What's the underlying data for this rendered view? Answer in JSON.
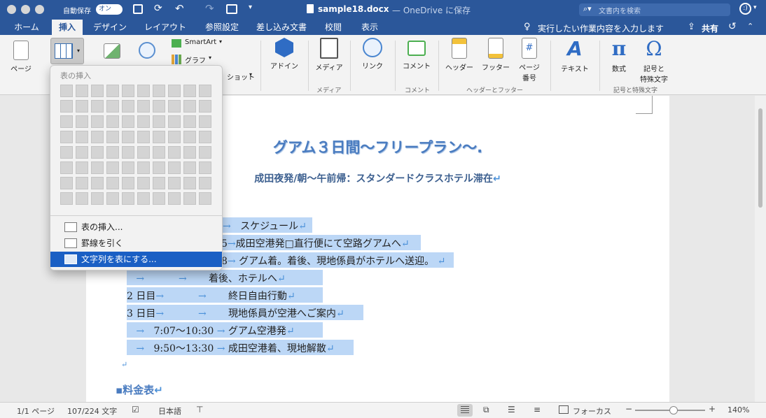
{
  "titlebar": {
    "autosave_label": "自動保存",
    "autosave_toggle": "オン",
    "doc_title": "sample18.docx",
    "doc_suffix": "— OneDrive に保存",
    "search_placeholder": "文書内を検索"
  },
  "tabs": [
    {
      "label": "ホーム"
    },
    {
      "label": "挿入"
    },
    {
      "label": "デザイン"
    },
    {
      "label": "レイアウト"
    },
    {
      "label": "参照設定"
    },
    {
      "label": "差し込み文書"
    },
    {
      "label": "校閲"
    },
    {
      "label": "表示"
    }
  ],
  "tell_me": "実行したい作業内容を入力します",
  "share": "共有",
  "ribbon": {
    "page": "ページ",
    "smartart": "SmartArt",
    "graph": "グラフ",
    "screenshot": "ショット",
    "addin": "アドイン",
    "media": "メディア",
    "link": "リンク",
    "comment": "コメント",
    "header": "ヘッダー",
    "footer": "フッター",
    "page_number_1": "ページ",
    "page_number_2": "番号",
    "textbox": "テキスト",
    "equation": "数式",
    "symbol_1": "記号と",
    "symbol_2": "特殊文字",
    "groups": {
      "media": "メディア",
      "comment": "コメント",
      "header_footer": "ヘッダーとフッター",
      "symbols": "記号と特殊文字"
    }
  },
  "dropdown": {
    "header": "表の挿入",
    "items": [
      {
        "label": "表の挿入..."
      },
      {
        "label": "罫線を引く"
      },
      {
        "label": "文字列を表にする..."
      }
    ]
  },
  "document": {
    "title": "グアム３日間〜フリープラン〜",
    "subtitle": "成田夜発/朝〜午前帰：スタンダードクラスホテル滞在",
    "lines": [
      {
        "day": "",
        "time": "",
        "text": "スケジュール"
      },
      {
        "day": "",
        "time": "5",
        "text": "成田空港発□直行便にて空路グアムへ"
      },
      {
        "day": "",
        "time": "8",
        "text": "グアム着。着後、現地係員がホテルへ送迎。"
      },
      {
        "day": "",
        "time": "",
        "text": "着後、ホテルへ"
      },
      {
        "day": "2 日目",
        "time": "",
        "text": "終日自由行動"
      },
      {
        "day": "3 日目",
        "time": "",
        "text": "現地係員が空港へご案内"
      },
      {
        "day": "",
        "time": "7:07〜10:30",
        "text": "グアム空港発"
      },
      {
        "day": "",
        "time": "9:50〜13:30",
        "text": "成田空港着、現地解散"
      }
    ],
    "section_heading": "料金表"
  },
  "status": {
    "page": "1/1 ページ",
    "words": "107/224 文字",
    "language": "日本語",
    "focus": "フォーカス",
    "zoom": "140%",
    "zoom_level": 0.55
  },
  "colors": {
    "brand": "#2b579a",
    "title": "#4a7cc0",
    "selection": "#bcd7f6",
    "menu_highlight": "#1a5fc4"
  }
}
